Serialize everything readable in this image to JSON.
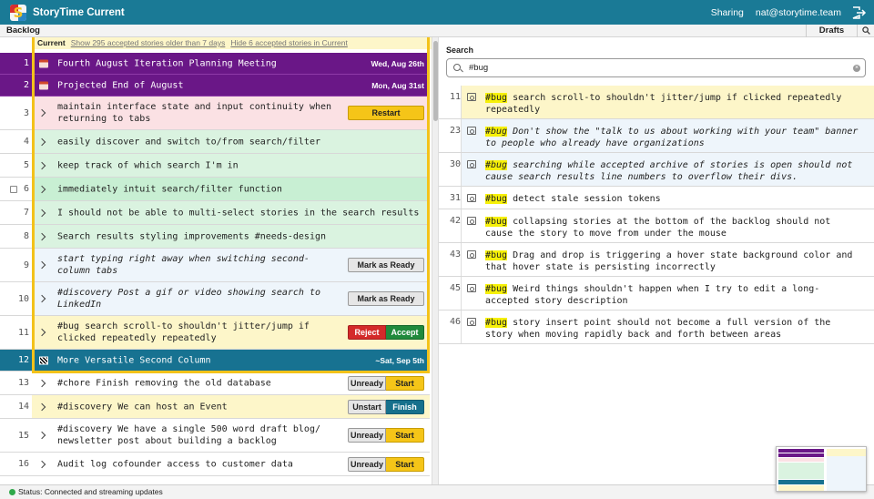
{
  "app": {
    "title": "StoryTime Current",
    "logo_letter": "S",
    "sharing_label": "Sharing",
    "account_email": "nat@storytime.team"
  },
  "tabs": {
    "backlog": "Backlog",
    "drafts": "Drafts"
  },
  "current": {
    "label": "Current",
    "show_older_link": "Show 295 accepted stories older than 7 days",
    "hide_accepted_link": "Hide 6 accepted stories in Current"
  },
  "backlog": [
    {
      "num": "1",
      "kind": "iteration",
      "text": "Fourth August Iteration Planning Meeting",
      "date": "Wed, Aug 26th"
    },
    {
      "num": "2",
      "kind": "iteration",
      "text": "Projected End of August",
      "date": "Mon, Aug 31st"
    },
    {
      "num": "3",
      "kind": "story",
      "bg": "#fbe1e4",
      "text_lines": [
        "maintain interface state and input continuity when",
        "returning to tabs"
      ],
      "buttons": [
        {
          "label": "Restart",
          "style": "yellow"
        }
      ]
    },
    {
      "num": "4",
      "kind": "story",
      "bg": "#daf3e0",
      "text_lines": [
        "easily discover and switch to/from search/filter"
      ]
    },
    {
      "num": "5",
      "kind": "story",
      "bg": "#daf3e0",
      "text_lines": [
        "keep track of which search I'm in"
      ]
    },
    {
      "num": "6",
      "kind": "story",
      "bg": "#c8efd3",
      "text_lines": [
        "immediately intuit search/filter function"
      ],
      "has_checkbox": true
    },
    {
      "num": "7",
      "kind": "story",
      "bg": "#daf3e0",
      "text_lines": [
        "I should not be able to multi-select stories in the search results"
      ]
    },
    {
      "num": "8",
      "kind": "story",
      "bg": "#daf3e0",
      "text_lines": [
        "Search results styling improvements #needs-design"
      ]
    },
    {
      "num": "9",
      "kind": "story",
      "bg": "#eef5fb",
      "italic": true,
      "text_lines": [
        "start typing right away when switching second-",
        "column tabs"
      ],
      "buttons": [
        {
          "label": "Mark as Ready",
          "style": "grey"
        }
      ]
    },
    {
      "num": "10",
      "kind": "story",
      "bg": "#eef5fb",
      "italic": true,
      "text_lines": [
        "#discovery Post a gif or video showing search to",
        "LinkedIn"
      ],
      "buttons": [
        {
          "label": "Mark as Ready",
          "style": "grey"
        }
      ]
    },
    {
      "num": "11",
      "kind": "story",
      "bg": "#fdf6c9",
      "text_lines": [
        "#bug search scroll-to shouldn't jitter/jump if",
        "clicked repeatedly repeatedly"
      ],
      "buttons": [
        {
          "label": "Reject",
          "style": "red"
        },
        {
          "label": "Accept",
          "style": "green"
        }
      ]
    },
    {
      "num": "12",
      "kind": "release",
      "text": "More Versatile Second Column",
      "date": "~Sat, Sep 5th"
    },
    {
      "num": "13",
      "kind": "story",
      "bg": "#ffffff",
      "text_lines": [
        "#chore Finish removing the old database"
      ],
      "buttons": [
        {
          "label": "Unready",
          "style": "grey"
        },
        {
          "label": "Start",
          "style": "yellow"
        }
      ]
    },
    {
      "num": "14",
      "kind": "story",
      "bg": "#fdf6c9",
      "text_lines": [
        "#discovery We can host an Event"
      ],
      "buttons": [
        {
          "label": "Unstart",
          "style": "grey"
        },
        {
          "label": "Finish",
          "style": "teal"
        }
      ]
    },
    {
      "num": "15",
      "kind": "story",
      "bg": "#ffffff",
      "text_lines": [
        "#discovery We have a single 500 word draft blog/",
        "newsletter post about building a backlog"
      ],
      "buttons": [
        {
          "label": "Unready",
          "style": "grey"
        },
        {
          "label": "Start",
          "style": "yellow"
        }
      ]
    },
    {
      "num": "16",
      "kind": "story",
      "bg": "#ffffff",
      "text_lines": [
        "Audit log cofounder access to customer data"
      ],
      "buttons": [
        {
          "label": "Unready",
          "style": "grey"
        },
        {
          "label": "Start",
          "style": "yellow"
        }
      ]
    }
  ],
  "search": {
    "label": "Search",
    "query": "#bug",
    "results": [
      {
        "num": "11",
        "bg": "#fdf6c9",
        "tag": "#bug",
        "rest": " search scroll-to shouldn't jitter/jump if clicked repeatedly repeatedly"
      },
      {
        "num": "23",
        "bg": "#eef5fb",
        "italic": true,
        "tag": "#bug",
        "rest": " Don't show the \"talk to us about working with your team\" banner to people who already have organizations"
      },
      {
        "num": "30",
        "bg": "#eef5fb",
        "italic": true,
        "tag": "#bug",
        "rest": " searching while accepted archive of stories is open should not cause search results line numbers to overflow their divs."
      },
      {
        "num": "31",
        "bg": "#ffffff",
        "tag": "#bug",
        "rest": " detect stale session tokens"
      },
      {
        "num": "42",
        "bg": "#ffffff",
        "tag": "#bug",
        "rest": " collapsing stories at the bottom of the backlog should not cause the story to move from under the mouse"
      },
      {
        "num": "43",
        "bg": "#ffffff",
        "tag": "#bug",
        "rest": " Drag and drop is triggering a hover state background color and that hover state is persisting incorrectly"
      },
      {
        "num": "45",
        "bg": "#ffffff",
        "tag": "#bug",
        "rest": " Weird things shouldn't happen when I try to edit a long-accepted story description"
      },
      {
        "num": "46",
        "bg": "#ffffff",
        "tag": "#bug",
        "rest": " story insert point should not become a full version of the story when moving rapidly back and forth between areas"
      }
    ]
  },
  "status": {
    "text": "Status: Connected and streaming updates",
    "color": "#2fa84a"
  }
}
